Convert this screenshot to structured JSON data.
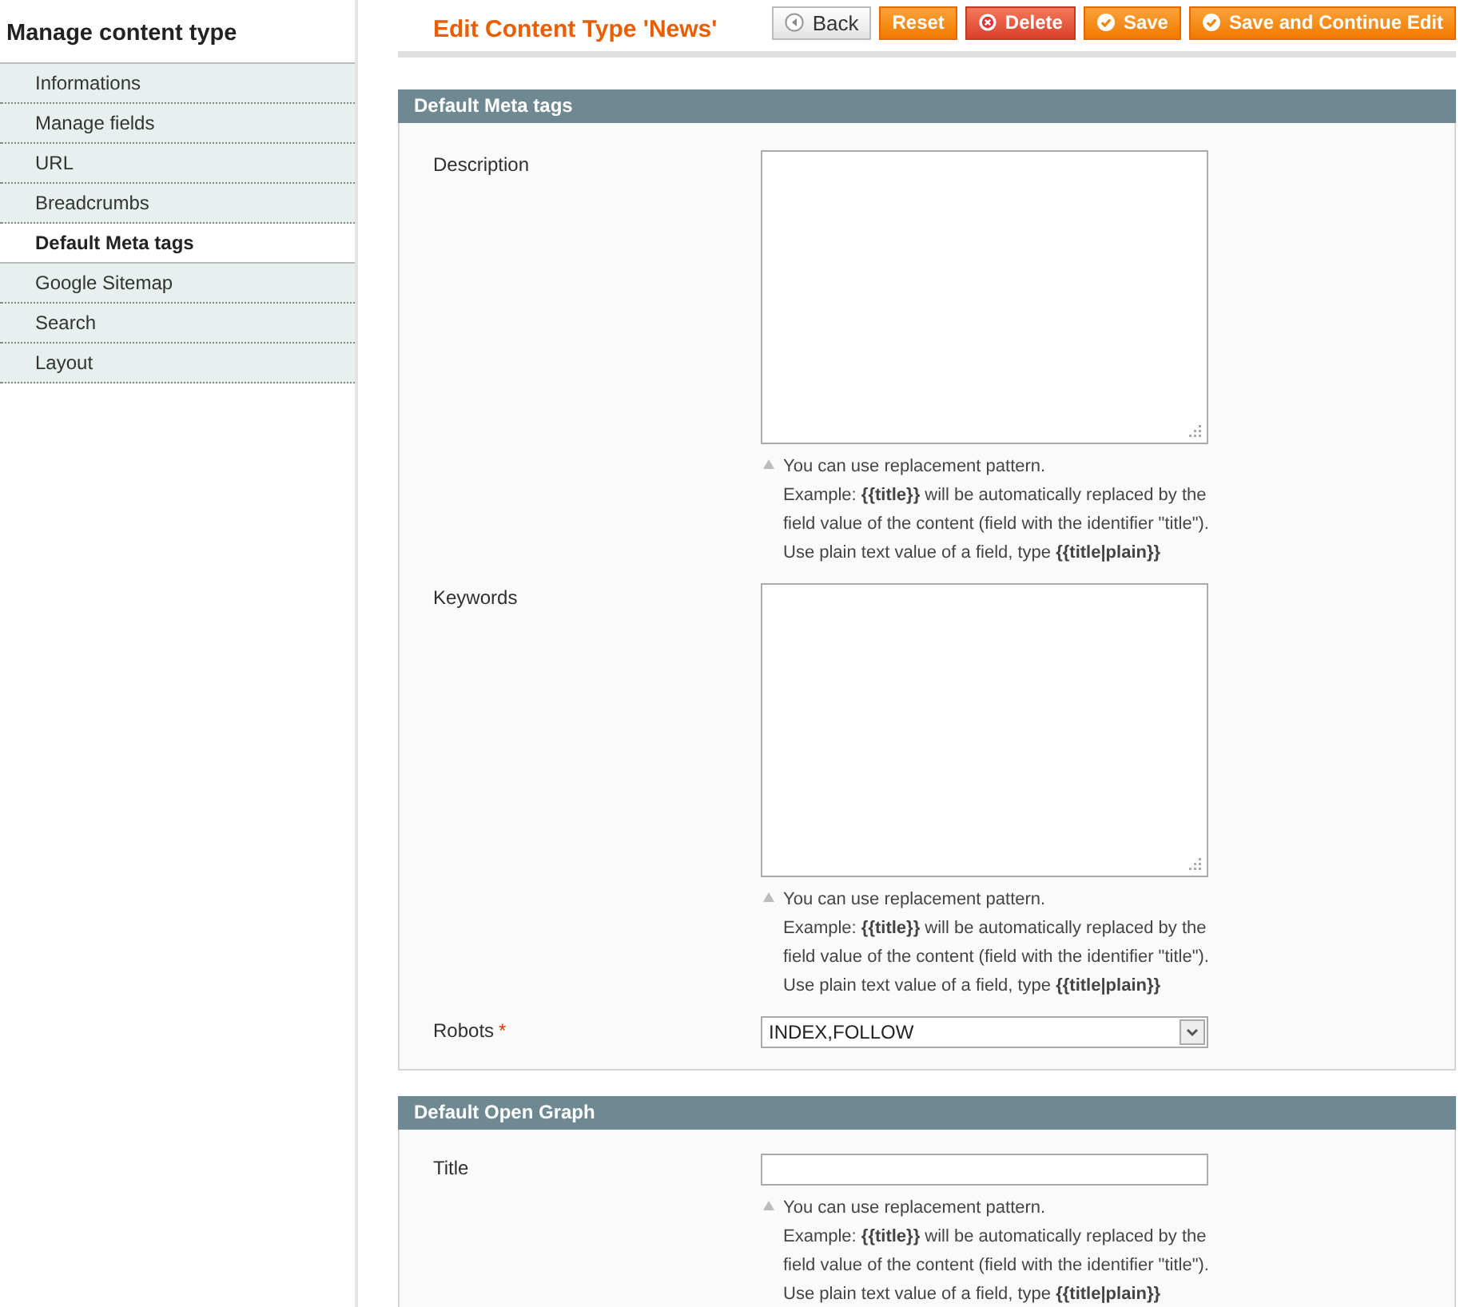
{
  "sidebar": {
    "title": "Manage content type",
    "items": [
      {
        "label": "Informations",
        "selected": false
      },
      {
        "label": "Manage fields",
        "selected": false
      },
      {
        "label": "URL",
        "selected": false
      },
      {
        "label": "Breadcrumbs",
        "selected": false
      },
      {
        "label": "Default Meta tags",
        "selected": true
      },
      {
        "label": "Google Sitemap",
        "selected": false
      },
      {
        "label": "Search",
        "selected": false
      },
      {
        "label": "Layout",
        "selected": false
      }
    ]
  },
  "header": {
    "title": "Edit Content Type 'News'",
    "buttons": [
      {
        "label": "Back",
        "kind": "back"
      },
      {
        "label": "Reset",
        "kind": "plain"
      },
      {
        "label": "Delete",
        "kind": "delete"
      },
      {
        "label": "Save",
        "kind": "save"
      },
      {
        "label": "Save and Continue Edit",
        "kind": "save"
      }
    ]
  },
  "sections": [
    {
      "title": "Default Meta tags",
      "fields": [
        {
          "label": "Description",
          "kind": "textarea",
          "note": [
            "You can use replacement pattern.",
            "Example: **{{title}}** will be automatically replaced by the",
            "field value of the content (field with the identifier \"title\").",
            "Use plain text value of a field, type **{{title|plain}}**"
          ]
        },
        {
          "label": "Keywords",
          "kind": "textarea",
          "note": [
            "You can use replacement pattern.",
            "Example: **{{title}}** will be automatically replaced by the",
            "field value of the content (field with the identifier \"title\").",
            "Use plain text value of a field, type **{{title|plain}}**"
          ]
        },
        {
          "label": "Robots",
          "kind": "select",
          "required_mark": "*",
          "value": "INDEX,FOLLOW"
        }
      ]
    },
    {
      "title": "Default Open Graph",
      "fields": [
        {
          "label": "Title",
          "kind": "input",
          "note": [
            "You can use replacement pattern.",
            "Example: **{{title}}** will be automatically replaced by the",
            "field value of the content (field with the identifier \"title\").",
            "Use plain text value of a field, type **{{title|plain}}**"
          ]
        }
      ]
    }
  ]
}
